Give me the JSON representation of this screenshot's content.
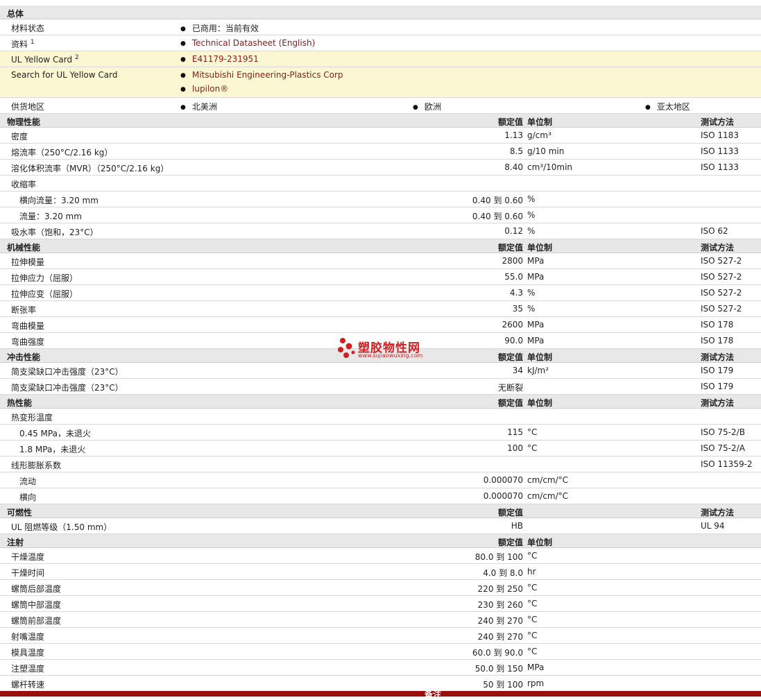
{
  "general": {
    "title": "总体",
    "material_status_label": "材料状态",
    "material_status_value": "已商用：当前有效",
    "docs_label": "资料",
    "docs_sup": "1",
    "docs_value": "Technical Datasheet (English)",
    "ul_label": "UL Yellow Card",
    "ul_sup": "2",
    "ul_value": "E41179-231951",
    "search_label": "Search for UL Yellow Card",
    "search_values": [
      "Mitsubishi Engineering-Plastics Corp",
      "Iupilon®"
    ],
    "supply_label": "供货地区",
    "supply_values": [
      "北美洲",
      "欧洲",
      "亚太地区"
    ]
  },
  "headers": {
    "rated": "额定值",
    "unit": "单位制",
    "test": "测试方法"
  },
  "physical": {
    "title": "物理性能",
    "rows": [
      {
        "label": "密度",
        "value": "1.13",
        "unit": "g/cm³",
        "test": "ISO 1183"
      },
      {
        "label": "熔流率（250°C/2.16 kg）",
        "value": "8.5",
        "unit": "g/10 min",
        "test": "ISO 1133"
      },
      {
        "label": "溶化体积流率（MVR）（250°C/2.16 kg）",
        "value": "8.40",
        "unit": "cm³/10min",
        "test": "ISO 1133"
      },
      {
        "label": "收缩率",
        "value": "",
        "unit": "",
        "test": ""
      },
      {
        "label": "横向流量：3.20 mm",
        "value": "0.40 到  0.60",
        "unit": "%",
        "test": ""
      },
      {
        "label": "流量：3.20 mm",
        "value": "0.40 到  0.60",
        "unit": "%",
        "test": ""
      },
      {
        "label": "吸水率（饱和，23°C）",
        "value": "0.12",
        "unit": "%",
        "test": "ISO 62"
      }
    ]
  },
  "mechanical": {
    "title": "机械性能",
    "rows": [
      {
        "label": "拉伸模量",
        "value": "2800",
        "unit": "MPa",
        "test": "ISO 527-2"
      },
      {
        "label": "拉伸应力（屈服）",
        "value": "55.0",
        "unit": "MPa",
        "test": "ISO 527-2"
      },
      {
        "label": "拉伸应变（屈服）",
        "value": "4.3",
        "unit": "%",
        "test": "ISO 527-2"
      },
      {
        "label": "断张率",
        "value": "35",
        "unit": "%",
        "test": "ISO 527-2"
      },
      {
        "label": "弯曲模量",
        "value": "2600",
        "unit": "MPa",
        "test": "ISO 178"
      },
      {
        "label": "弯曲强度",
        "value": "90.0",
        "unit": "MPa",
        "test": "ISO 178"
      }
    ]
  },
  "impact": {
    "title": "冲击性能",
    "rows": [
      {
        "label": "简支梁缺口冲击强度（23°C）",
        "value": "34",
        "unit": "kJ/m²",
        "test": "ISO 179"
      },
      {
        "label": "简支梁缺口冲击强度（23°C）",
        "value": "无断裂",
        "unit": "",
        "test": "ISO 179"
      }
    ]
  },
  "thermal": {
    "title": "热性能",
    "rows": [
      {
        "label": "热变形温度",
        "value": "",
        "unit": "",
        "test": ""
      },
      {
        "label": "0.45 MPa，未退火",
        "value": "115",
        "unit": "°C",
        "test": "ISO 75-2/B"
      },
      {
        "label": "1.8 MPa，未退火",
        "value": "100",
        "unit": "°C",
        "test": "ISO 75-2/A"
      },
      {
        "label": "线形膨胀系数",
        "value": "",
        "unit": "",
        "test": "ISO 11359-2"
      },
      {
        "label": "流动",
        "value": "0.000070",
        "unit": "cm/cm/°C",
        "test": ""
      },
      {
        "label": "横向",
        "value": "0.000070",
        "unit": "cm/cm/°C",
        "test": ""
      }
    ]
  },
  "flammability": {
    "title": "可燃性",
    "rows": [
      {
        "label": "UL 阻燃等级（1.50 mm）",
        "value": "HB",
        "unit": "",
        "test": "UL 94"
      }
    ]
  },
  "injection": {
    "title": "注射",
    "rows": [
      {
        "label": "干燥温度",
        "value": "80.0 到  100",
        "unit": "°C"
      },
      {
        "label": "干燥时间",
        "value": "4.0 到  8.0",
        "unit": "hr"
      },
      {
        "label": "螺筒后部温度",
        "value": "220 到  250",
        "unit": "°C"
      },
      {
        "label": "螺筒中部温度",
        "value": "230 到  260",
        "unit": "°C"
      },
      {
        "label": "螺筒前部温度",
        "value": "240 到  270",
        "unit": "°C"
      },
      {
        "label": "射嘴温度",
        "value": "240 到  270",
        "unit": "°C"
      },
      {
        "label": "模具温度",
        "value": "60.0 到  90.0",
        "unit": "°C"
      },
      {
        "label": "注塑温度",
        "value": "50.0 到  150",
        "unit": "MPa"
      },
      {
        "label": "螺杆转速",
        "value": "50 到  100",
        "unit": "rpm"
      }
    ]
  },
  "watermark": {
    "title": "塑胶物性网",
    "url": "www.sujiaowuxing.com"
  },
  "footer": {
    "label": "备注"
  }
}
